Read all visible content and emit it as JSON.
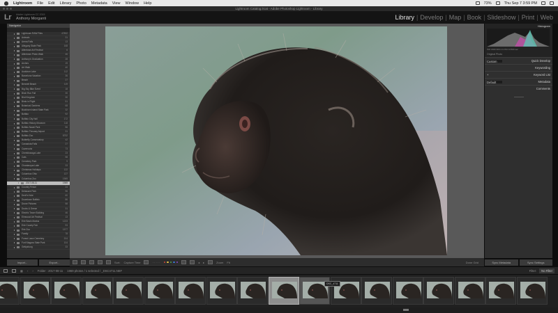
{
  "menubar": {
    "items": [
      "Lightroom",
      "File",
      "Edit",
      "Library",
      "Photo",
      "Metadata",
      "View",
      "Window",
      "Help"
    ],
    "datetime": "Thu Sep 7  3:59 PM",
    "battery": "73%"
  },
  "window": {
    "title": "Lightroom Catalog.lrcat - Adobe Photoshop Lightroom - Library"
  },
  "identity": {
    "logo": "Lr",
    "sub": "Adobe Lightroom CC 2015",
    "name": "Anthony Morganti"
  },
  "modules": [
    "Library",
    "Develop",
    "Map",
    "Book",
    "Slideshow",
    "Print",
    "Web"
  ],
  "active_module": "Library",
  "left_panel": {
    "navigator_label": "Navigator",
    "folders": [
      {
        "name": "Lightroom RAW Files",
        "count": "47892"
      },
      {
        "name": "Animals",
        "count": "31"
      },
      {
        "name": "Arena Falls",
        "count": "13"
      },
      {
        "name": "Allegany State Park",
        "count": "168"
      },
      {
        "name": "Allentown Art Festival",
        "count": "6"
      },
      {
        "name": "Allentown Photo Walk",
        "count": "46"
      },
      {
        "name": "Anthony's Graduation",
        "count": "28"
      },
      {
        "name": "Arches",
        "count": "19"
      },
      {
        "name": "Art Walk",
        "count": "40"
      },
      {
        "name": "Audubon Lake",
        "count": "112"
      },
      {
        "name": "Barcelona Vacation",
        "count": "36"
      },
      {
        "name": "Beach",
        "count": "27"
      },
      {
        "name": "Bennett Beach",
        "count": "119"
      },
      {
        "name": "Big Sky Bike Event",
        "count": "18"
      },
      {
        "name": "Birch Run Fall",
        "count": "30"
      },
      {
        "name": "Bird Kingdom",
        "count": "30"
      },
      {
        "name": "Birds in Flight",
        "count": "51"
      },
      {
        "name": "Botanical Gardens",
        "count": "68"
      },
      {
        "name": "Buckhorn Island State Park",
        "count": "32"
      },
      {
        "name": "Buffalo",
        "count": "92"
      },
      {
        "name": "Buffalo City Hall",
        "count": "172"
      },
      {
        "name": "Buffalo History Museum",
        "count": "118"
      },
      {
        "name": "Buffalo Naval Park",
        "count": "56"
      },
      {
        "name": "Buffalo Thruway Airport",
        "count": "31"
      },
      {
        "name": "Buffalo Zoo",
        "count": "8752"
      },
      {
        "name": "Butterfly Conservatory",
        "count": "42"
      },
      {
        "name": "Canastota Falls",
        "count": "27"
      },
      {
        "name": "Cazenovia",
        "count": "73"
      },
      {
        "name": "Cheektowaga Lake",
        "count": "23"
      },
      {
        "name": "Cats",
        "count": "98"
      },
      {
        "name": "Cemetery Park",
        "count": "9"
      },
      {
        "name": "Chautauqua Lake",
        "count": "33"
      },
      {
        "name": "Christmas Holidays",
        "count": "122"
      },
      {
        "name": "Columbus Ohio",
        "count": "127"
      },
      {
        "name": "Columbus Zoo",
        "count": "1969"
      },
      {
        "name": "2017-08-11",
        "count": "1969",
        "selected": true
      },
      {
        "name": "Country Fence",
        "count": "24"
      },
      {
        "name": "Delaware Park",
        "count": "96"
      },
      {
        "name": "Devil's Hole",
        "count": "60"
      },
      {
        "name": "Downtown Buffalo",
        "count": "86"
      },
      {
        "name": "Drone Pictures",
        "count": "58"
      },
      {
        "name": "Ducks & Geese",
        "count": "31"
      },
      {
        "name": "Electric Tower Building",
        "count": "46"
      },
      {
        "name": "Elmwood Art Festival",
        "count": "13"
      },
      {
        "name": "Erie Basin Marina",
        "count": "1223"
      },
      {
        "name": "Erie County Fair",
        "count": "93"
      },
      {
        "name": "Erie Zoo",
        "count": "1577"
      },
      {
        "name": "Family",
        "count": "78"
      },
      {
        "name": "Forest Lawn Cemetery",
        "count": "204"
      },
      {
        "name": "Fort Niagara State Park",
        "count": "104"
      },
      {
        "name": "Gettysburg",
        "count": "33"
      }
    ],
    "import_label": "Import...",
    "export_label": "Export..."
  },
  "toolbar": {
    "sort_label": "Sort:",
    "sort_value": "Capture Time",
    "label_colors": [
      "#d14a3a",
      "#e3c444",
      "#4ea34a",
      "#3a73d1",
      "#9048c8"
    ],
    "zoom_label": "Zoom",
    "zoom_value": "Fit",
    "done_label": "Done Grid"
  },
  "right_panel": {
    "histogram_label": "Histogram",
    "histogram_meta": "ISO 1600    300 mm    f/6.3    1/500 sec",
    "original_photo": "Original Photo",
    "panels": [
      {
        "label": "Quick Develop",
        "select": "Custom"
      },
      {
        "label": "Keywording"
      },
      {
        "label": "Keyword List"
      },
      {
        "label": "Metadata",
        "select": "Default"
      },
      {
        "label": "Comments"
      }
    ],
    "sync_metadata": "Sync Metadata",
    "sync_settings": "Sync Settings"
  },
  "filmbar": {
    "secondary": "1",
    "primary": "2",
    "folder_path": "Folder : 2017-08-11",
    "photo_count": "1969 photos / 1 selected / _DSC4711.NEF",
    "filter_label": "Filter:",
    "filter_value": "No Filter"
  },
  "filmstrip": {
    "frame_count": 18,
    "selected_index": 9,
    "tooltip": "DSC_4711"
  }
}
